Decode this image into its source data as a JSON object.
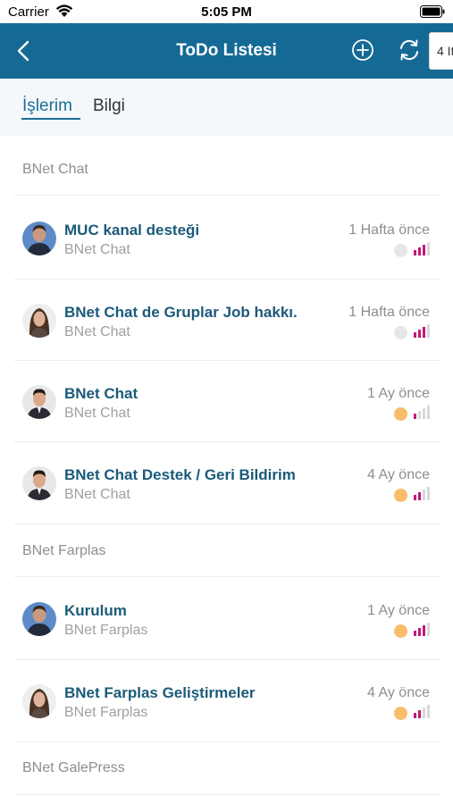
{
  "status_bar": {
    "carrier": "Carrier",
    "time": "5:05 PM"
  },
  "nav": {
    "title": "ToDo Listesi",
    "count_label": "4 It"
  },
  "tabs": {
    "active": "İşlerim",
    "inactive": "Bilgi"
  },
  "sections": [
    {
      "title": "BNet Chat"
    },
    {
      "title": "BNet Farplas"
    },
    {
      "title": "BNet GalePress"
    }
  ],
  "tasks": [
    {
      "name": "MUC kanal desteği",
      "project": "BNet Chat",
      "time": "1 Hafta önce",
      "dot_color": "#e6e6e6"
    },
    {
      "name": "BNet Chat de Gruplar Job hakkı.",
      "project": "BNet Chat",
      "time": "1 Hafta önce",
      "dot_color": "#e6e6e6"
    },
    {
      "name": "BNet Chat",
      "project": "BNet Chat",
      "time": "1 Ay önce",
      "dot_color": "#f7bd6a"
    },
    {
      "name": "BNet Chat Destek / Geri Bildirim",
      "project": "BNet Chat",
      "time": "4 Ay önce",
      "dot_color": "#f7bd6a"
    },
    {
      "name": "Kurulum",
      "project": "BNet Farplas",
      "time": "1 Ay önce",
      "dot_color": "#f7bd6a"
    },
    {
      "name": "BNet Farplas Geliştirmeler",
      "project": "BNet Farplas",
      "time": "4 Ay önce",
      "dot_color": "#f7bd6a"
    }
  ],
  "colors": {
    "nav_bg": "#156a95",
    "accent": "#1c6e96",
    "priority_bar": "#c2187a"
  }
}
